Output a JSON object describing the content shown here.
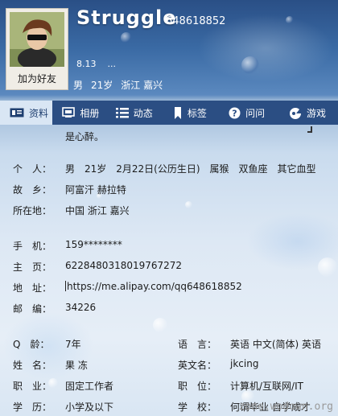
{
  "profile": {
    "nickname": "Struggle",
    "qq_number": "648618852",
    "status_date": "8.13",
    "status_more": "...",
    "summary": [
      "男",
      "21岁",
      "浙江 嘉兴"
    ],
    "add_friend_label": "加为好友"
  },
  "tabs": [
    {
      "label": "资料",
      "icon": "profile-card-icon"
    },
    {
      "label": "相册",
      "icon": "photo-album-icon"
    },
    {
      "label": "动态",
      "icon": "feed-list-icon"
    },
    {
      "label": "标签",
      "icon": "bookmark-icon"
    },
    {
      "label": "问问",
      "icon": "question-icon"
    },
    {
      "label": "游戏",
      "icon": "game-icon"
    }
  ],
  "signature_tail": "是心醉。",
  "details": {
    "person": {
      "label": "个　人：",
      "value": "男　21岁　2月22日(公历生日)　属猴　双鱼座　其它血型"
    },
    "hometown": {
      "label": "故　乡：",
      "value": "阿富汗 赫拉特"
    },
    "location": {
      "label": "所在地：",
      "value": "中国 浙江 嘉兴"
    },
    "mobile": {
      "label": "手　机：",
      "value": "159********"
    },
    "homepage": {
      "label": "主　页：",
      "value": "6228480318019767272"
    },
    "address": {
      "label": "地　址：",
      "value": "https://me.alipay.com/qq648618852"
    },
    "zip": {
      "label": "邮　编：",
      "value": "34226"
    },
    "q_age": {
      "label": "Q　龄：",
      "value": "7年"
    },
    "language": {
      "label": "语　言：",
      "value": "英语 中文(简体) 英语"
    },
    "name": {
      "label": "姓　名：",
      "value": "果 冻"
    },
    "english_name": {
      "label": "英文名：",
      "value": "jkcing"
    },
    "occupation": {
      "label": "职　业：",
      "value": "固定工作者"
    },
    "position": {
      "label": "职　位：",
      "value": "计算机/互联网/IT"
    },
    "education": {
      "label": "学　历：",
      "value": "小学及以下"
    },
    "school": {
      "label": "学　校：",
      "value": "何谓毕业 自学成才"
    }
  },
  "watermark": "zone.wodown.org"
}
